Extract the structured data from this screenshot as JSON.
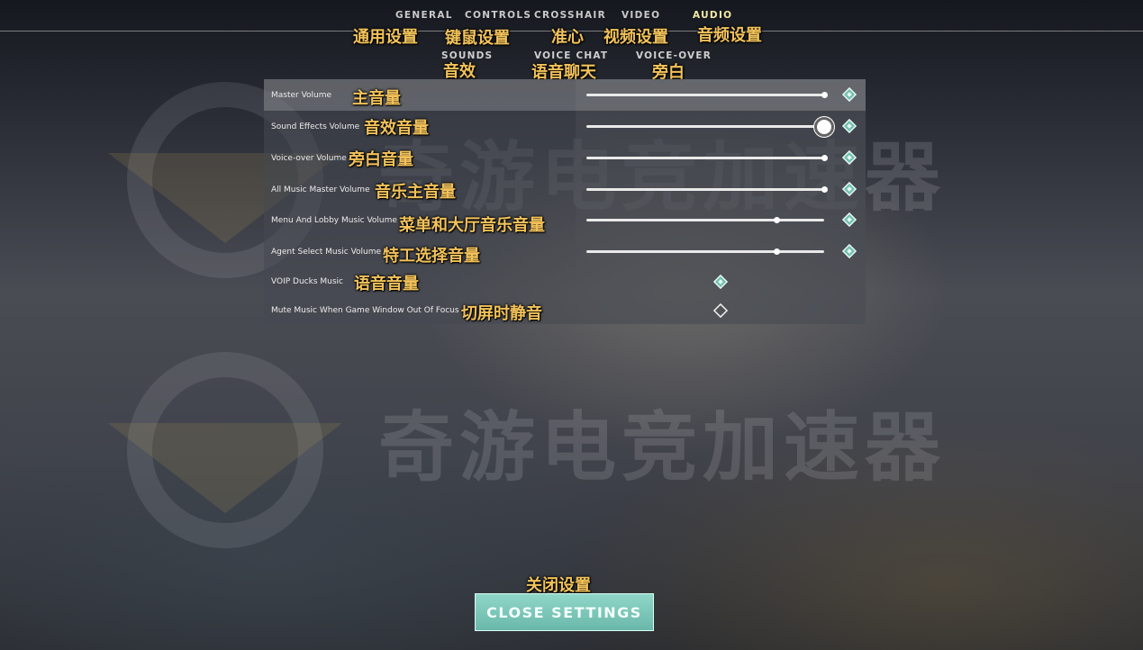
{
  "tabs": [
    {
      "label": "GENERAL",
      "annotation": "通用设置"
    },
    {
      "label": "CONTROLS",
      "annotation": "键鼠设置"
    },
    {
      "label": "CROSSHAIR",
      "annotation": "准心"
    },
    {
      "label": "VIDEO",
      "annotation": "视频设置"
    },
    {
      "label": "AUDIO",
      "annotation": "音频设置",
      "active": true
    }
  ],
  "subtabs": [
    {
      "label": "SOUNDS",
      "annotation": "音效"
    },
    {
      "label": "VOICE CHAT",
      "annotation": "语音聊天"
    },
    {
      "label": "VOICE-OVER",
      "annotation": "旁白"
    }
  ],
  "settings": [
    {
      "label": "Master Volume",
      "annotation": "主音量",
      "type": "slider",
      "value": 1.0,
      "highlighted": true
    },
    {
      "label": "Sound Effects Volume",
      "annotation": "音效音量",
      "type": "slider",
      "value": 1.0,
      "active_knob": true
    },
    {
      "label": "Voice-over Volume",
      "annotation": "旁白音量",
      "type": "slider",
      "value": 1.0
    },
    {
      "label": "All Music Master Volume",
      "annotation": "音乐主音量",
      "type": "slider",
      "value": 1.0
    },
    {
      "label": "Menu And Lobby Music Volume",
      "annotation": "菜单和大厅音乐音量",
      "type": "slider",
      "value": 0.8
    },
    {
      "label": "Agent Select Music Volume",
      "annotation": "特工选择音量",
      "type": "slider",
      "value": 0.8
    },
    {
      "label": "VOIP Ducks Music",
      "annotation": "语音音量",
      "type": "checkbox",
      "checked": true
    },
    {
      "label": "Mute Music When Game Window Out Of Focus",
      "annotation": "切屏时静音",
      "type": "checkbox",
      "checked": false
    }
  ],
  "watermark": {
    "text": "奇游电竞加速器"
  },
  "footer": {
    "close_label": "CLOSE SETTINGS",
    "close_annotation": "关闭设置"
  },
  "colors": {
    "accent": "#7fcbbd",
    "annotation": "#f2c25a",
    "active_tab": "#f3e9a5"
  }
}
